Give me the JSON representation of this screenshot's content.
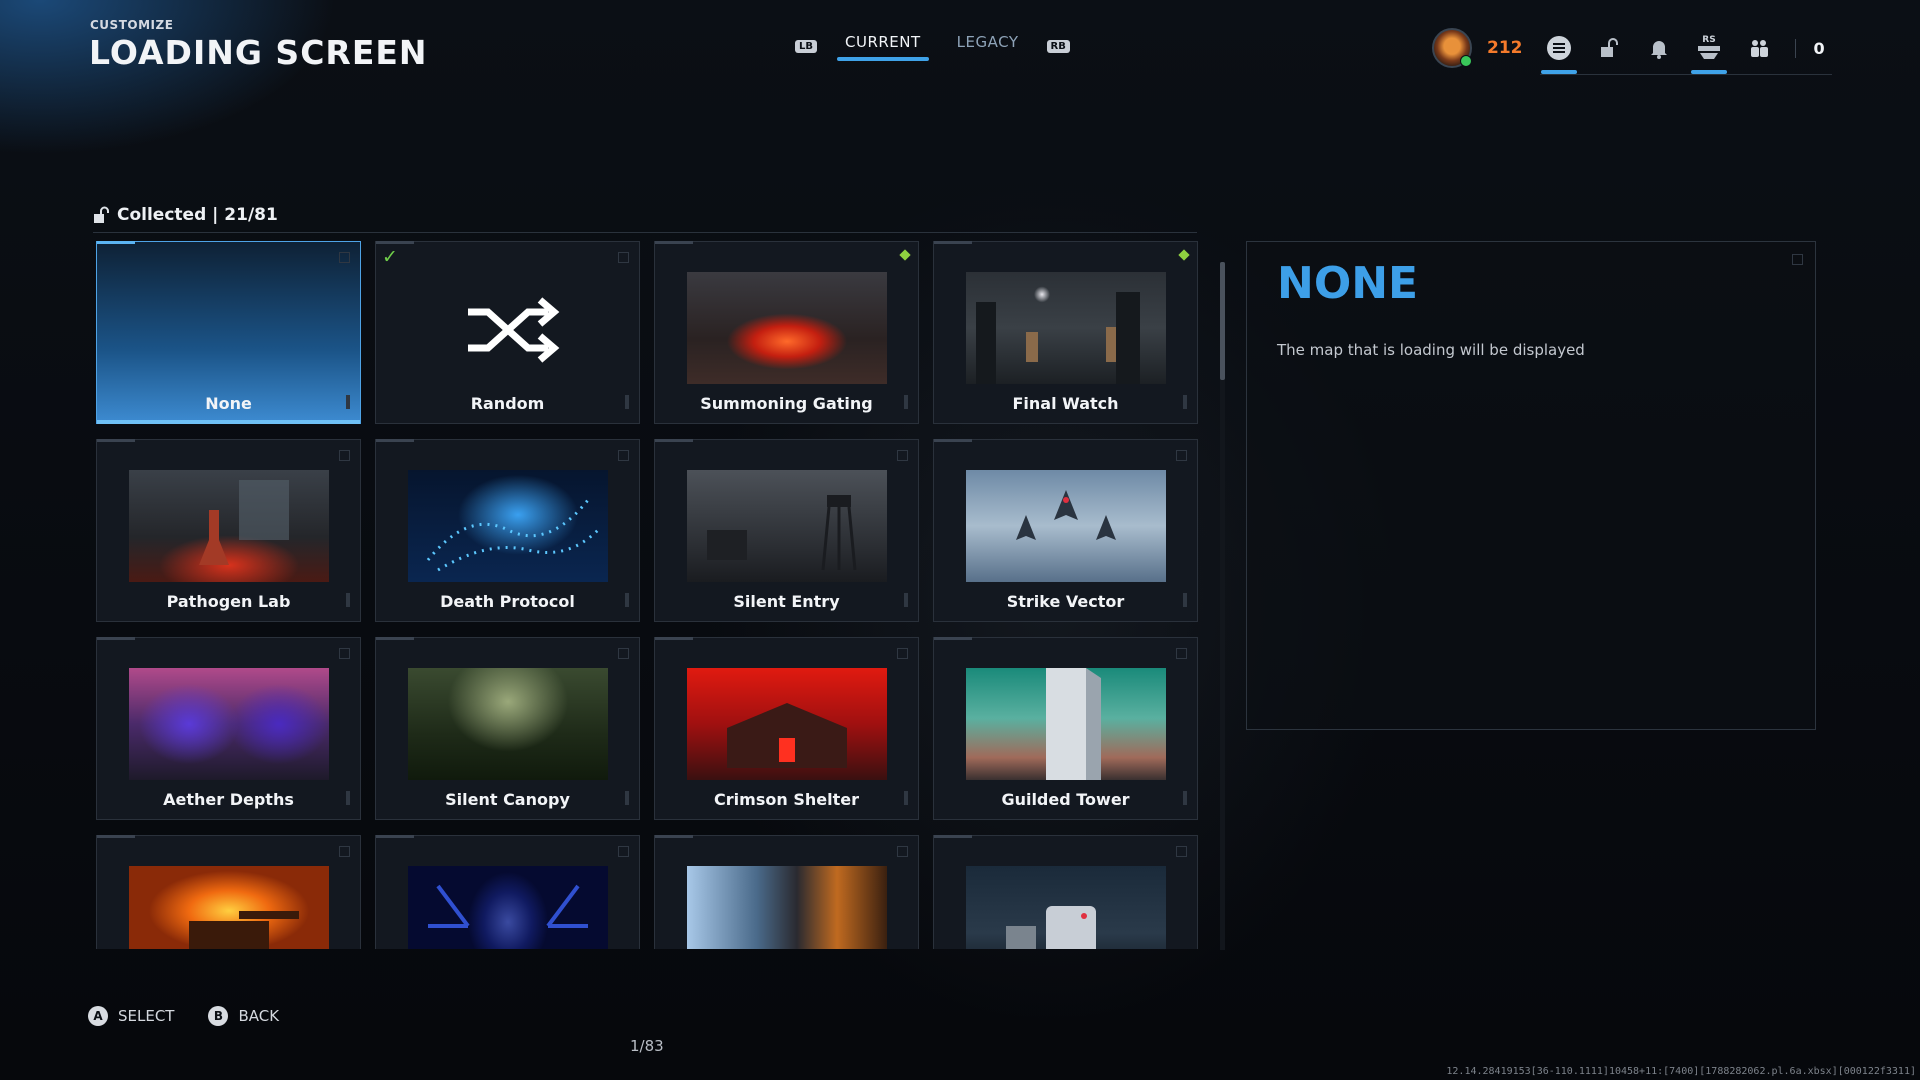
{
  "header": {
    "subtitle": "CUSTOMIZE",
    "title": "LOADING SCREEN"
  },
  "tabs": {
    "left_bumper": "LB",
    "right_bumper": "RB",
    "items": [
      {
        "label": "CURRENT",
        "active": true
      },
      {
        "label": "LEGACY",
        "active": false
      }
    ]
  },
  "topbar": {
    "points": "212",
    "rs_label": "RS",
    "count": "0",
    "icons": [
      "avatar-emblem",
      "menu-icon",
      "unlock-icon",
      "bell-icon",
      "rs-stack-icon",
      "party-icon"
    ]
  },
  "collection": {
    "label": "Collected | 21/81"
  },
  "cards": [
    {
      "label": "None",
      "selected": true
    },
    {
      "label": "Random",
      "equipped": true
    },
    {
      "label": "Summoning Gating",
      "new": true
    },
    {
      "label": "Final Watch",
      "new": true
    },
    {
      "label": "Pathogen Lab"
    },
    {
      "label": "Death Protocol"
    },
    {
      "label": "Silent Entry"
    },
    {
      "label": "Strike Vector"
    },
    {
      "label": "Aether Depths"
    },
    {
      "label": "Silent Canopy"
    },
    {
      "label": "Crimson Shelter"
    },
    {
      "label": "Guilded Tower"
    },
    {
      "label": ""
    },
    {
      "label": ""
    },
    {
      "label": ""
    },
    {
      "label": ""
    }
  ],
  "detail": {
    "title": "NONE",
    "description": "The map that is loading will be displayed"
  },
  "footer": {
    "select": {
      "glyph": "A",
      "label": "SELECT"
    },
    "back": {
      "glyph": "B",
      "label": "BACK"
    },
    "page": "1/83",
    "build": "12.14.28419153[36-110.1111]10458+11:[7400][1788282062.pl.6a.xbsx][000122f3311]"
  },
  "colors": {
    "accent": "#3fa2e8",
    "points": "#f47a2b",
    "new_badge": "#8fd140",
    "equipped_check": "#6fce49"
  }
}
